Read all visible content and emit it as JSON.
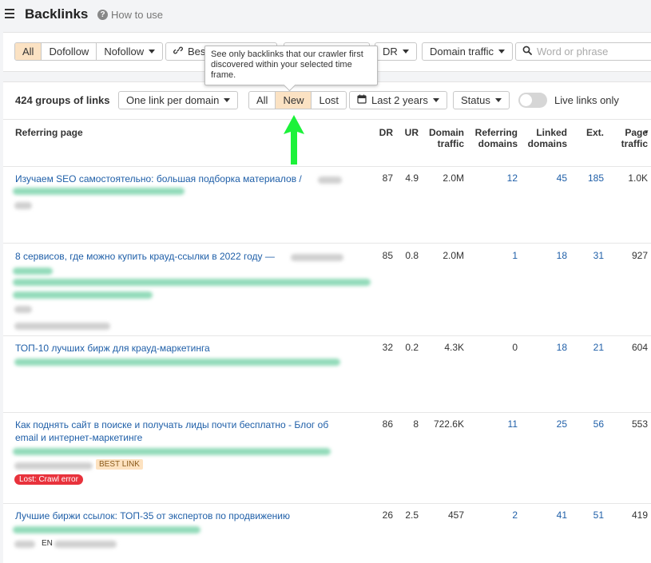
{
  "header": {
    "title": "Backlinks",
    "help_label": "How to use"
  },
  "filters": {
    "link_type": [
      "All",
      "Dofollow",
      "Nofollow"
    ],
    "best_label": "Best",
    "dr_label": "DR",
    "domain_traffic_label": "Domain traffic",
    "search_placeholder": "Word or phrase"
  },
  "tooltip": {
    "text": "See only backlinks that our crawler first discovered within your selected time frame."
  },
  "controls": {
    "groups": "424 groups of links",
    "per_domain": "One link per domain",
    "time_filter": [
      "All",
      "New",
      "Lost"
    ],
    "period": "Last 2 years",
    "status": "Status",
    "live_only": "Live links only"
  },
  "columns": {
    "referring_page": "Referring page",
    "dr": "DR",
    "ur": "UR",
    "domain_traffic": "Domain traffic",
    "referring_domains": "Referring domains",
    "linked_domains": "Linked domains",
    "ext": "Ext.",
    "page_traffic": "Page traffic"
  },
  "rows": [
    {
      "title": "Изучаем SEO самостоятельно: большая подборка материалов /",
      "dr": "87",
      "ur": "4.9",
      "domain_traffic": "2.0M",
      "referring_domains": "12",
      "linked_domains": "45",
      "ext": "185",
      "page_traffic": "1.0K"
    },
    {
      "title": "8 сервисов, где можно купить крауд-ссылки в 2022 году —",
      "dr": "85",
      "ur": "0.8",
      "domain_traffic": "2.0M",
      "referring_domains": "1",
      "linked_domains": "18",
      "ext": "31",
      "page_traffic": "927"
    },
    {
      "title": "ТОП-10 лучших бирж для крауд-маркетинга",
      "dr": "32",
      "ur": "0.2",
      "domain_traffic": "4.3K",
      "referring_domains": "0",
      "linked_domains": "18",
      "ext": "21",
      "page_traffic": "604"
    },
    {
      "title": "Как поднять сайт в поиске и получать лиды почти бесплатно - Блог об email и интернет-маркетинге",
      "dr": "86",
      "ur": "8",
      "domain_traffic": "722.6K",
      "referring_domains": "11",
      "linked_domains": "25",
      "ext": "56",
      "page_traffic": "553",
      "best_tag": "BEST LINK",
      "lost_tag": "Lost: Crawl error"
    },
    {
      "title": "Лучшие биржи ссылок: ТОП-35 от экспертов по продвижению",
      "dr": "26",
      "ur": "2.5",
      "domain_traffic": "457",
      "referring_domains": "2",
      "linked_domains": "41",
      "ext": "51",
      "page_traffic": "419",
      "lang_tag": "EN"
    }
  ]
}
